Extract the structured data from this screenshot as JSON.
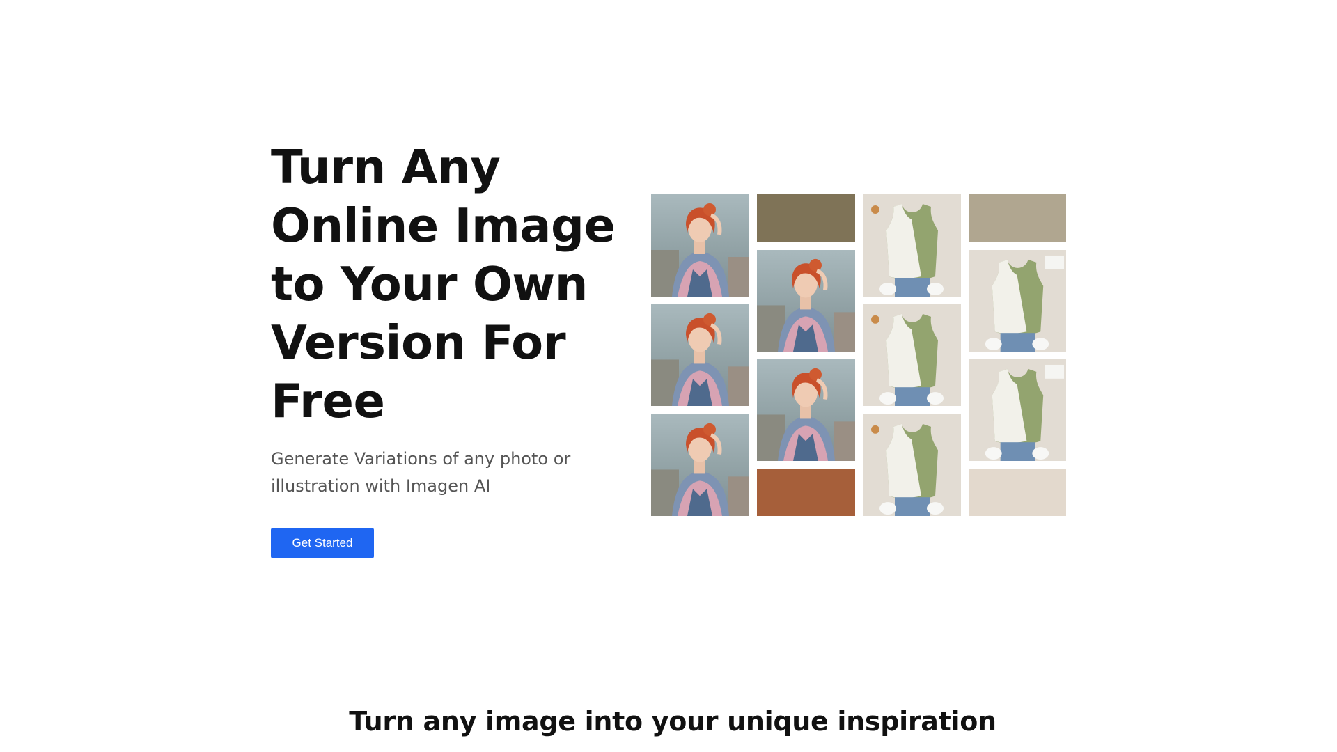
{
  "hero": {
    "title_lines": [
      "Turn Any",
      "Online Image",
      "to Your Own",
      "Version For",
      "Free"
    ],
    "subtitle": "Generate Variations of any photo or illustration with Imagen AI",
    "cta_label": "Get Started"
  },
  "gallery": {
    "tiles": [
      {
        "kind": "portrait-photo"
      },
      {
        "kind": "color-swatch",
        "color": "#7f7357"
      },
      {
        "kind": "tank-top-photo"
      },
      {
        "kind": "color-swatch",
        "color": "#b0a690"
      },
      {
        "kind": "portrait-photo"
      },
      {
        "kind": "portrait-photo"
      },
      {
        "kind": "tank-top-photo"
      },
      {
        "kind": "tank-top-photo"
      },
      {
        "kind": "portrait-photo"
      },
      {
        "kind": "portrait-photo"
      },
      {
        "kind": "tank-top-photo"
      },
      {
        "kind": "tank-top-photo"
      },
      {
        "kind": "color-swatch",
        "color": "#a65f3a"
      },
      {
        "kind": "color-swatch",
        "color": "#e3d9cd"
      }
    ]
  },
  "section": {
    "heading": "Turn any image into your unique inspiration"
  },
  "colors": {
    "accent": "#1f66f2",
    "text": "#111111",
    "muted": "#555555"
  }
}
